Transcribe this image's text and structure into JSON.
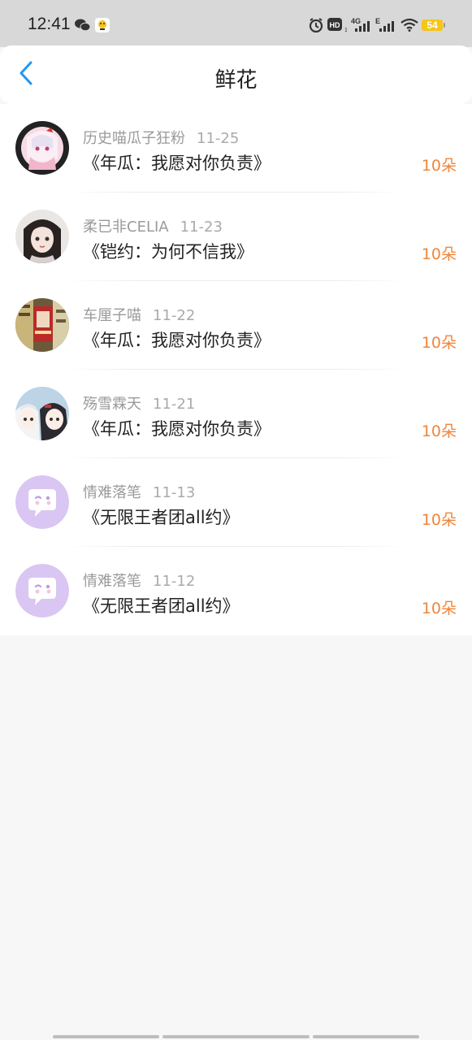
{
  "status_bar": {
    "time": "12:41",
    "battery": "54",
    "icons": [
      "wechat-icon",
      "app-notification-icon",
      "alarm-icon",
      "hd-icon",
      "signal-4g-icon",
      "signal-e-icon",
      "wifi-icon",
      "battery-icon"
    ]
  },
  "header": {
    "title": "鲜花",
    "back_icon": "chevron-left-icon"
  },
  "records": [
    {
      "user": "历史喵瓜子狂粉",
      "date": "11-25",
      "book": "《年瓜：我愿对你负责》",
      "amount": "10朵",
      "avatar": "anime-girl-pink"
    },
    {
      "user": "柔已非CELIA",
      "date": "11-23",
      "book": "《铠约：为何不信我》",
      "amount": "10朵",
      "avatar": "doll-girl"
    },
    {
      "user": "车厘子喵",
      "date": "11-22",
      "book": "《年瓜：我愿对你负责》",
      "amount": "10朵",
      "avatar": "poster-collage"
    },
    {
      "user": "殇雪霖天",
      "date": "11-21",
      "book": "《年瓜：我愿对你负责》",
      "amount": "10朵",
      "avatar": "anime-duo"
    },
    {
      "user": "情难落笔",
      "date": "11-13",
      "book": "《无限王者团all约》",
      "amount": "10朵",
      "avatar": "default-chat-bubble"
    },
    {
      "user": "情难落笔",
      "date": "11-12",
      "book": "《无限王者团all约》",
      "amount": "10朵",
      "avatar": "default-chat-bubble"
    }
  ],
  "colors": {
    "accent": "#2196f3",
    "amount": "#f0853a",
    "default_avatar": "#d9c6f2"
  }
}
